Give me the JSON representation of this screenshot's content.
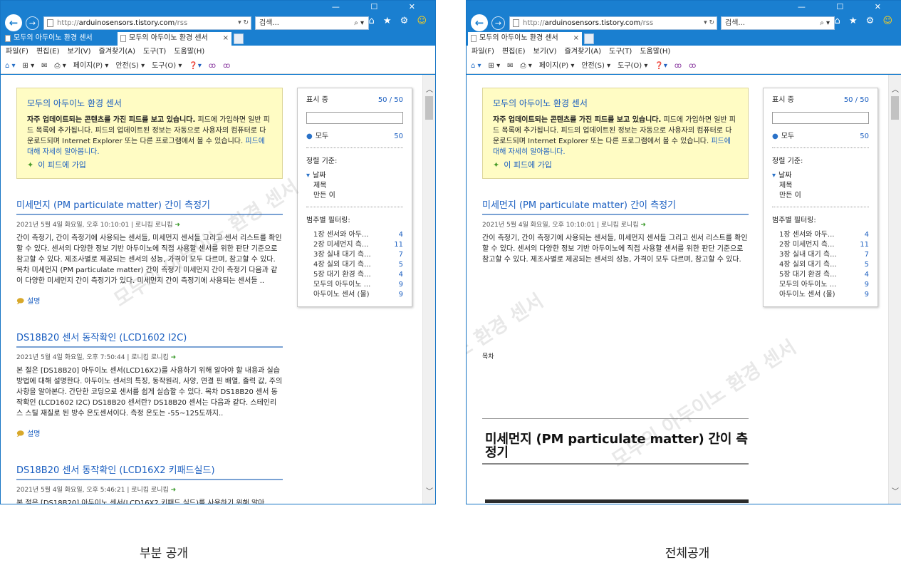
{
  "browser": {
    "url_prefix": "http://",
    "url_host": "arduinosensors.tistory.com",
    "url_path": "/rss",
    "addr_buttons": "▾ ↻",
    "search_placeholder": "검색...",
    "search_buttons": "⌕ ▾",
    "window_controls": "— ☐ ✕",
    "toolbar_icons": "⌂ ★ ⚙ ",
    "smiley": "☺",
    "tabs_left": [
      {
        "label": "모두의 아두이노 환경 센서"
      },
      {
        "label": "모두의 아두이노 환경 센서",
        "close": "×"
      }
    ],
    "tabs_right": [
      {
        "label": "모두의 아두이노 환경 센서",
        "close": "×"
      }
    ],
    "menu": [
      "파일(F)",
      "편집(E)",
      "보기(V)",
      "즐겨찾기(A)",
      "도구(T)",
      "도움말(H)"
    ],
    "cmd": {
      "home": "⌂ ▾",
      "feeds": "⊞ ▾",
      "mail": "✉",
      "print": "⎙ ▾",
      "page": "페이지(P) ▾",
      "safety": "안전(S) ▾",
      "tools": "도구(O) ▾",
      "help": "❓▾",
      "extra1": "ꝏ",
      "extra2": "ꝏ"
    }
  },
  "feed": {
    "title": "모두의 아두이노 환경 센서",
    "notice_bold": "자주 업데이트되는 콘텐츠를 가진 피드를 보고 있습니다.",
    "notice_text": " 피드에 가입하면 일반 피드 목록에 추가됩니다. 피드의 업데이트된 정보는 자동으로 사용자의 컴퓨터로 다운로드되며 Internet Explorer 또는 다른 프로그램에서 볼 수 있습니다. ",
    "notice_link": "피드에 대해 자세히 알아봅니다.",
    "subscribe_icon": "✦",
    "subscribe_label": "이 피드에 가입"
  },
  "sidebar": {
    "showing_label": "표시 중",
    "showing_count": "50 / 50",
    "all_bullet": "●",
    "all_label": "모두",
    "all_count": "50",
    "sort_label": "정렬 기준:",
    "sort_arrow": "▾",
    "sort_options": [
      "날짜",
      "제목",
      "만든 이"
    ],
    "filter_label": "범주별 필터링:",
    "categories": [
      {
        "name": "1장 센서와 아두...",
        "count": "4"
      },
      {
        "name": "2장 미세먼지 측...",
        "count": "11"
      },
      {
        "name": "3장 실내 대기 측...",
        "count": "7"
      },
      {
        "name": "4장 실외 대기 측...",
        "count": "5"
      },
      {
        "name": "5장 대기 환경 측...",
        "count": "4"
      },
      {
        "name": "모두의 아두이노 ...",
        "count": "9"
      },
      {
        "name": "아두이노 센서 (물)",
        "count": "9"
      }
    ]
  },
  "articles": [
    {
      "title": "미세먼지 (PM particulate matter) 간이 측정기",
      "meta": "2021년 5월 4일 화요일, 오후 10:10:01 | 로니킴 로니킴 ",
      "body_full": "간이 측정기, 간이 측정기에 사용되는 센서들, 미세먼지 센서들 그리고 센서 리스트를 확인할 수 있다. 센서의 다양한 정보 기반 아두이노에 직접 사용할 센서를 위한 판단 기준으로 참고할 수 있다. 제조사별로 제공되는 센서의 성능, 가격이 모두 다르며, 참고할 수 있다. 목차 미세먼지 (PM particulate matter) 간이 측정기 미세먼지 간이 측정기 다음과 같이 다양한 미세먼지 간이 측정기가 있다. 미세먼지 간이 측정기에 사용되는 센서들 ..",
      "body_partial": "간이 측정기, 간이 측정기에 사용되는 센서들, 미세먼지 센서들 그리고 센서 리스트를 확인할 수 있다. 센서의 다양한 정보 기반 아두이노에 직접 사용할 센서를 위한 판단 기준으로 참고할 수 있다. 제조사별로 제공되는 센서의 성능, 가격이 모두 다르며, 참고할 수 있다.",
      "desc": "설명"
    },
    {
      "title": "DS18B20 센서 동작확인 (LCD1602 I2C)",
      "meta": "2021년 5월 4일 화요일, 오후 7:50:44 | 로니킴 로니킴 ",
      "body": "본 절은 [DS18B20] 아두이노 센서(LCD16X2)를 사용하기 위해 알아야 할 내용과 실습 방법에 대해 설명한다. 아두이노 센서의 특징, 동작원리, 사양, 연결 핀 배열, 출력 값, 주의사항을 알아본다. 간단한 코딩으로 센서를 쉽게 실습할 수 있다. 목차 DS18B20 센서 동작확인 (LCD1602 I2C) DS18B20 센서란? DS18B20 센서는 다음과 같다. 스테인리스 스틸 재질로 된 방수 온도센서이다. 측정 온도는 -55~125도까지..",
      "desc": "설명"
    },
    {
      "title": "DS18B20 센서 동작확인 (LCD16X2 키패드실드)",
      "meta": "2021년 5월 4일 화요일, 오후 5:46:21 | 로니킴 로니킴 ",
      "body": "본 절은 [DS18B20] 아두이노 센서(LCD16X2 키패드 실드)를 사용하기 위해 알아"
    }
  ],
  "full_view": {
    "toc_label": "목차",
    "big_heading": "미세먼지 (PM particulate matter) 간이 측정기"
  },
  "meta_arrow": "➜",
  "desc_icon": "🗩",
  "watermark_text": "모두의 아두이노 환경 센서",
  "scroll_up": "︿",
  "scroll_down": "﹀",
  "captions": {
    "left": "부분 공개",
    "right": "전체공개"
  }
}
